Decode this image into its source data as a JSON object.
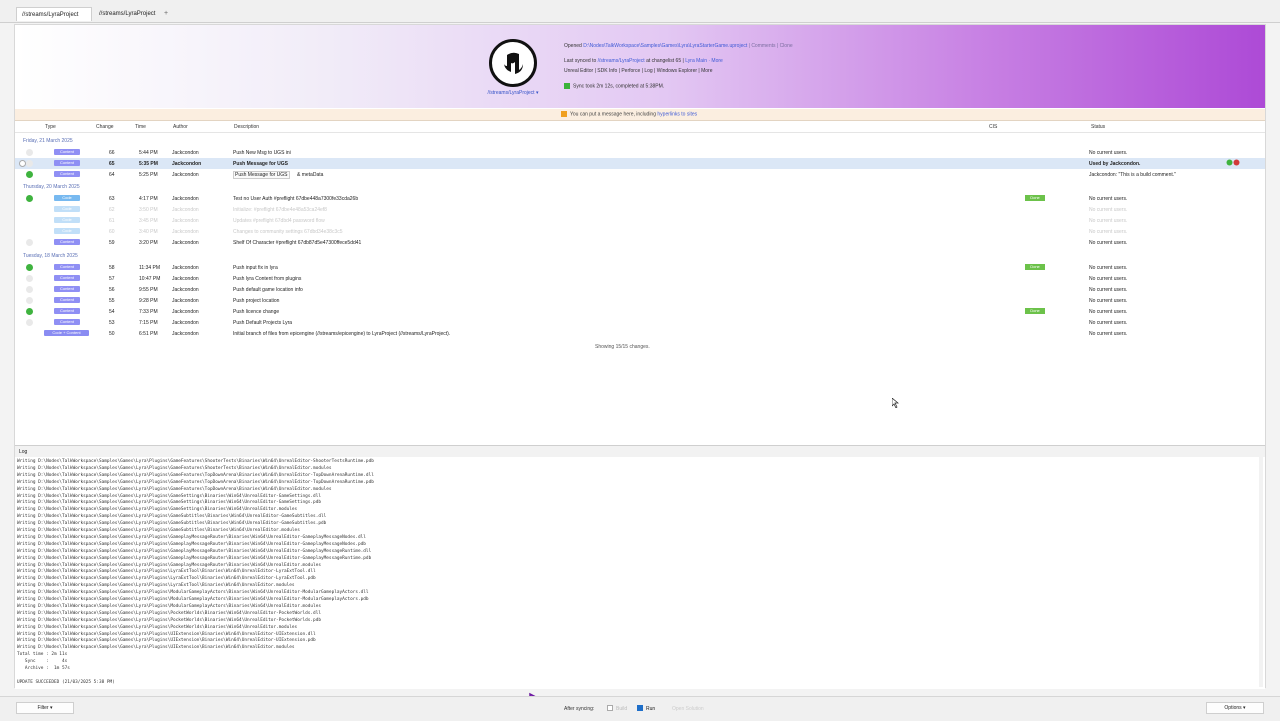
{
  "tabs": [
    {
      "label": "//streams/LyraProject"
    },
    {
      "label": "//streams/LyraProject"
    }
  ],
  "new_tab": "+",
  "banner": {
    "stream_link": "//streams/LyraProject ▾",
    "opened_prefix": "Opened",
    "opened_path": "D:\\Nodes\\TalkWorkspace\\Samples\\Games\\Lyra\\LyraStarterGame.uproject",
    "opened_suffix": "| Comments | Clone",
    "synced_prefix": "Last synced to",
    "synced_stream": "//streams/LyraProject",
    "synced_mid": "at changelist 65 |",
    "synced_more": "Lyra Main · More",
    "links_line": "Unreal Editor | SDK Info | Perforce | Log | Windows Explorer | More",
    "sync_status": "Sync took 2m 12s, completed at 5:38PM."
  },
  "message_bar": {
    "text": "You can put a message here, including",
    "link": "hyperlinks to sites"
  },
  "columns": {
    "type": "Type",
    "change": "Change",
    "time": "Time",
    "author": "Author",
    "description": "Description",
    "cis": "CIS",
    "status": "Status"
  },
  "groups": [
    "Friday, 21 March 2025",
    "Thursday, 20 March 2025",
    "Tuesday, 18 March 2025"
  ],
  "rows": [
    {
      "type": "Content",
      "change": "66",
      "time": "5:44 PM",
      "author": "Jackcondon",
      "description": "Push New Msg to UGS ini",
      "cis": "",
      "status": "No current users."
    },
    {
      "type": "Content",
      "change": "65",
      "time": "5:35 PM",
      "author": "Jackcondon",
      "description": "Push Message for UGS",
      "cis": "",
      "status": "Used by Jackcondon."
    },
    {
      "type": "Content",
      "change": "64",
      "time": "5:25 PM",
      "author": "Jackcondon",
      "description": "Push Message for UGS",
      "desc_extra": "& metaData",
      "cis": "",
      "status": "Jackcondon: \"This is a build comment.\""
    },
    {
      "type": "Code",
      "change": "63",
      "time": "4:17 PM",
      "author": "Jackcondon",
      "description": "Test no User Auth #preflight 67dbe448a7300fe33cda26b",
      "cis": "Done",
      "status": "No current users."
    },
    {
      "type": "Code",
      "change": "62",
      "time": "3:50 PM",
      "author": "Jackcondon",
      "description": "Initialize: #preflight 67dbe4e48a53ca24ef8",
      "cis": "",
      "status": "No current users."
    },
    {
      "type": "Code",
      "change": "61",
      "time": "3:45 PM",
      "author": "Jackcondon",
      "description": "Updates #preflight 67dbd4 password flow",
      "cis": "",
      "status": "No current users."
    },
    {
      "type": "Code",
      "change": "60",
      "time": "3:40 PM",
      "author": "Jackcondon",
      "description": "Changes to community settings 67dbd34e38c3c5",
      "cis": "",
      "status": "No current users."
    },
    {
      "type": "Content",
      "change": "59",
      "time": "3:20 PM",
      "author": "Jackcondon",
      "description": "Shelf Of Character #preflight 67db87d5e47300ffece5dd41",
      "cis": "",
      "status": "No current users."
    },
    {
      "type": "Content",
      "change": "58",
      "time": "11:34 PM",
      "author": "Jackcondon",
      "description": "Push input fix in lyra",
      "cis": "Done",
      "status": "No current users."
    },
    {
      "type": "Content",
      "change": "57",
      "time": "10:47 PM",
      "author": "Jackcondon",
      "description": "Push lyra Content from plugins",
      "cis": "",
      "status": "No current users."
    },
    {
      "type": "Content",
      "change": "56",
      "time": "9:55 PM",
      "author": "Jackcondon",
      "description": "Push default game location info",
      "cis": "",
      "status": "No current users."
    },
    {
      "type": "Content",
      "change": "55",
      "time": "9:28 PM",
      "author": "Jackcondon",
      "description": "Push project location",
      "cis": "",
      "status": "No current users."
    },
    {
      "type": "Content",
      "change": "54",
      "time": "7:33 PM",
      "author": "Jackcondon",
      "description": "Push licence change",
      "cis": "Done",
      "status": "No current users."
    },
    {
      "type": "Content",
      "change": "53",
      "time": "7:15 PM",
      "author": "Jackcondon",
      "description": "Push Default Projects Lyra",
      "cis": "",
      "status": "No current users."
    },
    {
      "type": "Code + Content",
      "change": "50",
      "time": "6:51 PM",
      "author": "Jackcondon",
      "description": "Initial branch of files from epicengine (//streams/epicengine) to LyraProject (//streams/LyraProject).",
      "cis": "",
      "status": "No current users."
    }
  ],
  "showing_text": "Showing 15/15 changes.",
  "log": {
    "title": "Log",
    "lines": [
      "Writing D:\\Nodes\\TalkWorkspace\\Samples\\Games\\Lyra\\Plugins\\GameFeatures\\ShooterTests\\Binaries\\Win64\\UnrealEditor-ShooterTestsRuntime.pdb",
      "Writing D:\\Nodes\\TalkWorkspace\\Samples\\Games\\Lyra\\Plugins\\GameFeatures\\ShooterTests\\Binaries\\Win64\\UnrealEditor.modules",
      "Writing D:\\Nodes\\TalkWorkspace\\Samples\\Games\\Lyra\\Plugins\\GameFeatures\\TopDownArena\\Binaries\\Win64\\UnrealEditor-TopDownArenaRuntime.dll",
      "Writing D:\\Nodes\\TalkWorkspace\\Samples\\Games\\Lyra\\Plugins\\GameFeatures\\TopDownArena\\Binaries\\Win64\\UnrealEditor-TopDownArenaRuntime.pdb",
      "Writing D:\\Nodes\\TalkWorkspace\\Samples\\Games\\Lyra\\Plugins\\GameFeatures\\TopDownArena\\Binaries\\Win64\\UnrealEditor.modules",
      "Writing D:\\Nodes\\TalkWorkspace\\Samples\\Games\\Lyra\\Plugins\\GameSettings\\Binaries\\Win64\\UnrealEditor-GameSettings.dll",
      "Writing D:\\Nodes\\TalkWorkspace\\Samples\\Games\\Lyra\\Plugins\\GameSettings\\Binaries\\Win64\\UnrealEditor-GameSettings.pdb",
      "Writing D:\\Nodes\\TalkWorkspace\\Samples\\Games\\Lyra\\Plugins\\GameSettings\\Binaries\\Win64\\UnrealEditor.modules",
      "Writing D:\\Nodes\\TalkWorkspace\\Samples\\Games\\Lyra\\Plugins\\GameSubtitles\\Binaries\\Win64\\UnrealEditor-GameSubtitles.dll",
      "Writing D:\\Nodes\\TalkWorkspace\\Samples\\Games\\Lyra\\Plugins\\GameSubtitles\\Binaries\\Win64\\UnrealEditor-GameSubtitles.pdb",
      "Writing D:\\Nodes\\TalkWorkspace\\Samples\\Games\\Lyra\\Plugins\\GameSubtitles\\Binaries\\Win64\\UnrealEditor.modules",
      "Writing D:\\Nodes\\TalkWorkspace\\Samples\\Games\\Lyra\\Plugins\\GameplayMessageRouter\\Binaries\\Win64\\UnrealEditor-GameplayMessageNodes.dll",
      "Writing D:\\Nodes\\TalkWorkspace\\Samples\\Games\\Lyra\\Plugins\\GameplayMessageRouter\\Binaries\\Win64\\UnrealEditor-GameplayMessageNodes.pdb",
      "Writing D:\\Nodes\\TalkWorkspace\\Samples\\Games\\Lyra\\Plugins\\GameplayMessageRouter\\Binaries\\Win64\\UnrealEditor-GameplayMessageRuntime.dll",
      "Writing D:\\Nodes\\TalkWorkspace\\Samples\\Games\\Lyra\\Plugins\\GameplayMessageRouter\\Binaries\\Win64\\UnrealEditor-GameplayMessageRuntime.pdb",
      "Writing D:\\Nodes\\TalkWorkspace\\Samples\\Games\\Lyra\\Plugins\\GameplayMessageRouter\\Binaries\\Win64\\UnrealEditor.modules",
      "Writing D:\\Nodes\\TalkWorkspace\\Samples\\Games\\Lyra\\Plugins\\LyraExtTool\\Binaries\\Win64\\UnrealEditor-LyraExtTool.dll",
      "Writing D:\\Nodes\\TalkWorkspace\\Samples\\Games\\Lyra\\Plugins\\LyraExtTool\\Binaries\\Win64\\UnrealEditor-LyraExtTool.pdb",
      "Writing D:\\Nodes\\TalkWorkspace\\Samples\\Games\\Lyra\\Plugins\\LyraExtTool\\Binaries\\Win64\\UnrealEditor.modules",
      "Writing D:\\Nodes\\TalkWorkspace\\Samples\\Games\\Lyra\\Plugins\\ModularGameplayActors\\Binaries\\Win64\\UnrealEditor-ModularGameplayActors.dll",
      "Writing D:\\Nodes\\TalkWorkspace\\Samples\\Games\\Lyra\\Plugins\\ModularGameplayActors\\Binaries\\Win64\\UnrealEditor-ModularGameplayActors.pdb",
      "Writing D:\\Nodes\\TalkWorkspace\\Samples\\Games\\Lyra\\Plugins\\ModularGameplayActors\\Binaries\\Win64\\UnrealEditor.modules",
      "Writing D:\\Nodes\\TalkWorkspace\\Samples\\Games\\Lyra\\Plugins\\PocketWorlds\\Binaries\\Win64\\UnrealEditor-PocketWorlds.dll",
      "Writing D:\\Nodes\\TalkWorkspace\\Samples\\Games\\Lyra\\Plugins\\PocketWorlds\\Binaries\\Win64\\UnrealEditor-PocketWorlds.pdb",
      "Writing D:\\Nodes\\TalkWorkspace\\Samples\\Games\\Lyra\\Plugins\\PocketWorlds\\Binaries\\Win64\\UnrealEditor.modules",
      "Writing D:\\Nodes\\TalkWorkspace\\Samples\\Games\\Lyra\\Plugins\\UIExtension\\Binaries\\Win64\\UnrealEditor-UIExtension.dll",
      "Writing D:\\Nodes\\TalkWorkspace\\Samples\\Games\\Lyra\\Plugins\\UIExtension\\Binaries\\Win64\\UnrealEditor-UIExtension.pdb",
      "Writing D:\\Nodes\\TalkWorkspace\\Samples\\Games\\Lyra\\Plugins\\UIExtension\\Binaries\\Win64\\UnrealEditor.modules",
      "Total time : 2m 11s",
      "   Sync    :     4s",
      "   Archive :  1m 57s",
      "",
      "UPDATE SUCCEEDED (21/03/2025 5:38 PM)"
    ]
  },
  "bottom": {
    "filter": "Filter",
    "after_syncing": "After syncing:",
    "build_label": "Build",
    "run_label": "Run",
    "open_label": "Open Solution",
    "options": "Options"
  },
  "colors": {
    "accent_purple": "#9b30d9",
    "content_tag": "#8f8ff4",
    "code_tag": "#77b9f0",
    "ok_green": "#3fb33f"
  }
}
